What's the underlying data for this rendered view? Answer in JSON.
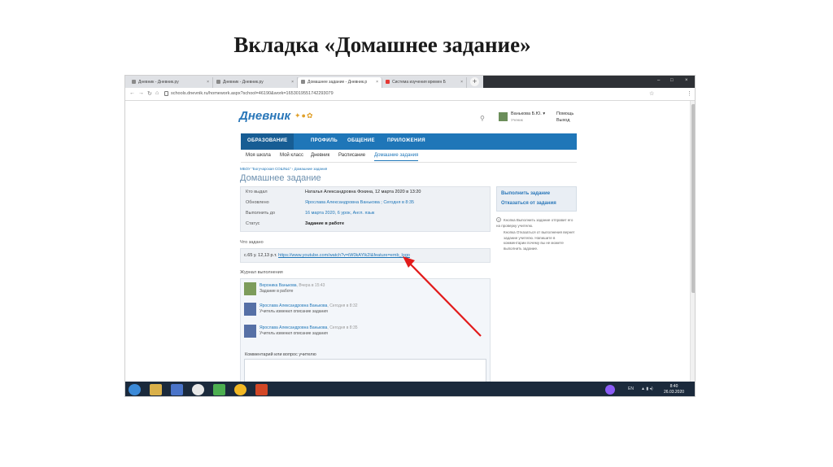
{
  "slide": {
    "title": "Вкладка «Домашнее задание»"
  },
  "browser": {
    "tabs": [
      {
        "label": "Дневник - Дневник.ру",
        "close": "×"
      },
      {
        "label": "Дневник - Дневник.ру",
        "close": "×"
      },
      {
        "label": "Домашнее задание - Дневник.р",
        "close": "×"
      },
      {
        "label": "Система изучения времен Б",
        "close": "×"
      }
    ],
    "new_tab": "+",
    "window_controls": [
      "–",
      "□",
      "×"
    ],
    "nav": {
      "back": "←",
      "forward": "→",
      "reload": "↻",
      "home": "⌂"
    },
    "url": "schools.dnevnik.ru/homework.aspx?school=46190&work=1653019551742293079",
    "star": "☆",
    "menu": "⋮"
  },
  "site": {
    "logo": "Дневник",
    "logo_decor": "✦●✿",
    "search_icon": "⚲",
    "user": {
      "name": "Ванькова Б.Ю. ▾",
      "role": "Ученик"
    },
    "help": "Помощь",
    "exit": "Выход",
    "main_nav": [
      "ОБРАЗОВАНИЕ",
      "ПРОФИЛЬ",
      "ОБЩЕНИЕ",
      "ПРИЛОЖЕНИЯ"
    ],
    "sub_nav": [
      "Моя школа",
      "Мой класс",
      "Дневник",
      "Расписание",
      "Домашние задания"
    ],
    "breadcrumbs": "МБОУ \"Богучарская СОШ№1\"  ›  Домашние задания",
    "page_title": "Домашнее задание"
  },
  "homework": {
    "rows": [
      {
        "label": "Кто выдал",
        "value": "Наталья Александровна Фокина, 12 марта 2020 в 13:20"
      },
      {
        "label": "Обновлено",
        "value": "Ярослава Александровна Ванькова ; Сегодня в 8:35"
      },
      {
        "label": "Выполнить до",
        "value": "16 марта 2020, 6 урок, Англ. язык"
      },
      {
        "label": "Статус",
        "value": "Задание в работе"
      }
    ],
    "task_label": "Что задано",
    "task_prefix": "с.65 у. 12,13 р.т.",
    "task_link": "https://www.youtube.com/watch?v=iW0kAYlk2I&feature=emb_logo"
  },
  "sidebar": {
    "do_task": "Выполнить задание",
    "refuse_task": "Отказаться от задания",
    "note_1": "Кнопка Выполнить задание отправит его на проверку учителю.",
    "note_2": "Кнопка Отказаться от выполнения вернет задание учителю. Напишите в комментарии почему вы не можете выполнить задание."
  },
  "journal": {
    "label": "Журнал выполнения",
    "entries": [
      {
        "name": "Вероника Ванькова",
        "time": ", Вчера в 15:43",
        "text": "Задание в работе"
      },
      {
        "name": "Ярослава Александровна Ванькова",
        "time": ", Сегодня в 8:32",
        "text": "Учитель изменил описание задания"
      },
      {
        "name": "Ярослава Александровна Ванькова",
        "time": ", Сегодня в 8:35",
        "text": "Учитель изменил описание задания"
      }
    ],
    "comment_label": "Комментарий или вопрос учителю"
  },
  "taskbar": {
    "lang": "EN",
    "clock_time": "8:40",
    "clock_date": "26.03.2020"
  },
  "colors": {
    "nav_blue": "#1f76b8",
    "arrow_red": "#e21b1b"
  }
}
